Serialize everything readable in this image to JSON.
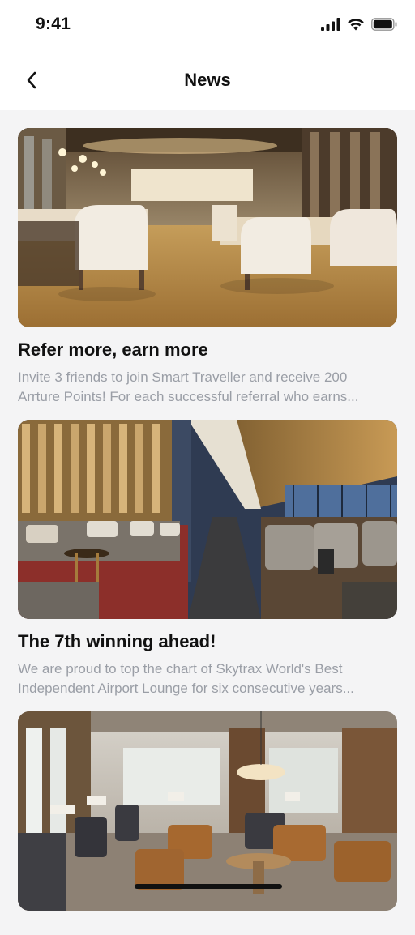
{
  "status": {
    "time": "9:41"
  },
  "nav": {
    "title": "News"
  },
  "articles": [
    {
      "title": "Refer more, earn more",
      "desc_line1": "Invite 3 friends to join Smart Traveller and receive 200",
      "desc_line2": "Arrture Points! For each successful referral who earns..."
    },
    {
      "title": "The 7th winning ahead!",
      "desc_line1": "We are proud to top the chart of Skytrax World's Best",
      "desc_line2": "Independent Airport Lounge for six consecutive years..."
    },
    {
      "title": "",
      "desc_line1": "",
      "desc_line2": ""
    }
  ]
}
